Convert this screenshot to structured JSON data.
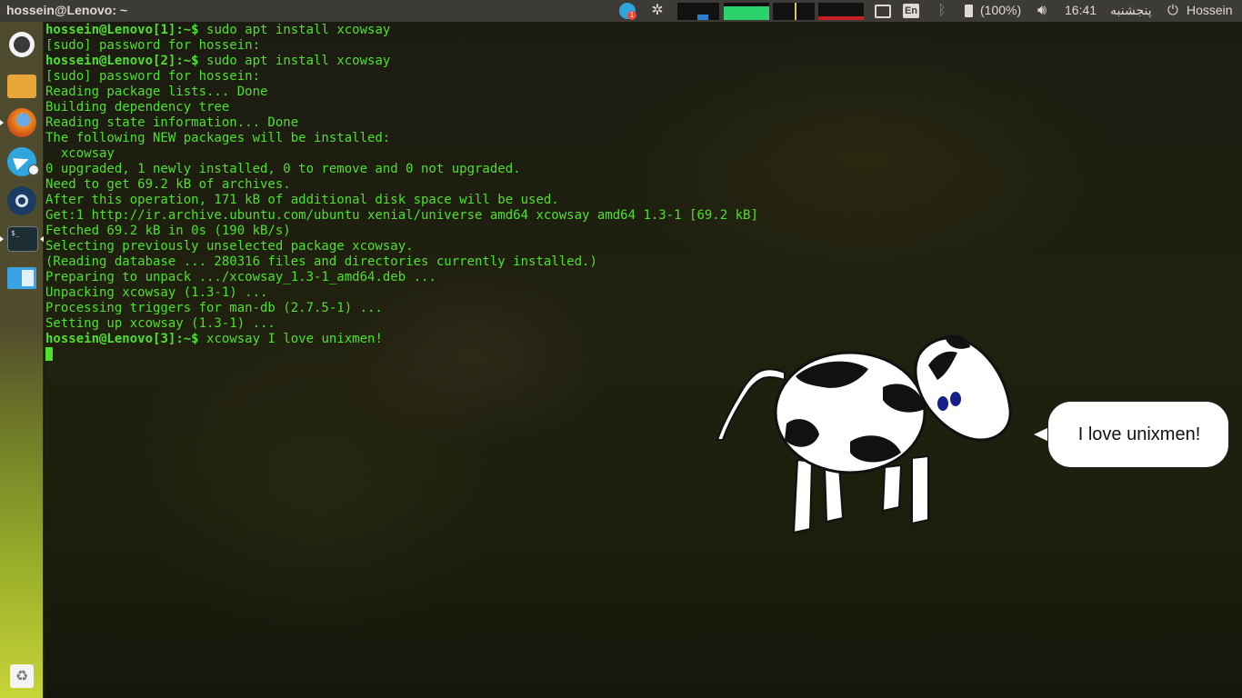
{
  "topbar": {
    "title": "hossein@Lenovo: ~",
    "telegram_badge": "1",
    "keyboard_layout": "En",
    "battery": "(100%)",
    "time": "16:41",
    "day": "پنجشنبه",
    "user": "Hossein"
  },
  "launcher": {
    "terminal_prompt": "$_"
  },
  "terminal": {
    "lines": [
      {
        "prompt": "hossein@Lenovo",
        "num": "[1]",
        "path": ":~$ ",
        "text": "sudo apt install xcowsay"
      },
      {
        "text": "[sudo] password for hossein:"
      },
      {
        "prompt": "hossein@Lenovo",
        "num": "[2]",
        "path": ":~$ ",
        "text": "sudo apt install xcowsay"
      },
      {
        "text": "[sudo] password for hossein:"
      },
      {
        "text": "Reading package lists... Done"
      },
      {
        "text": "Building dependency tree"
      },
      {
        "text": "Reading state information... Done"
      },
      {
        "text": "The following NEW packages will be installed:"
      },
      {
        "text": "  xcowsay"
      },
      {
        "text": "0 upgraded, 1 newly installed, 0 to remove and 0 not upgraded."
      },
      {
        "text": "Need to get 69.2 kB of archives."
      },
      {
        "text": "After this operation, 171 kB of additional disk space will be used."
      },
      {
        "text": "Get:1 http://ir.archive.ubuntu.com/ubuntu xenial/universe amd64 xcowsay amd64 1.3-1 [69.2 kB]"
      },
      {
        "text": "Fetched 69.2 kB in 0s (190 kB/s)"
      },
      {
        "text": "Selecting previously unselected package xcowsay."
      },
      {
        "text": "(Reading database ... 280316 files and directories currently installed.)"
      },
      {
        "text": "Preparing to unpack .../xcowsay_1.3-1_amd64.deb ..."
      },
      {
        "text": "Unpacking xcowsay (1.3-1) ..."
      },
      {
        "text": "Processing triggers for man-db (2.7.5-1) ..."
      },
      {
        "text": "Setting up xcowsay (1.3-1) ..."
      },
      {
        "prompt": "hossein@Lenovo",
        "num": "[3]",
        "path": ":~$ ",
        "text": "xcowsay I love unixmen!"
      }
    ]
  },
  "cow": {
    "message": "I love unixmen!"
  },
  "colors": {
    "terminal_text": "#4ee02a",
    "panel_bg": "#3c3b37"
  }
}
